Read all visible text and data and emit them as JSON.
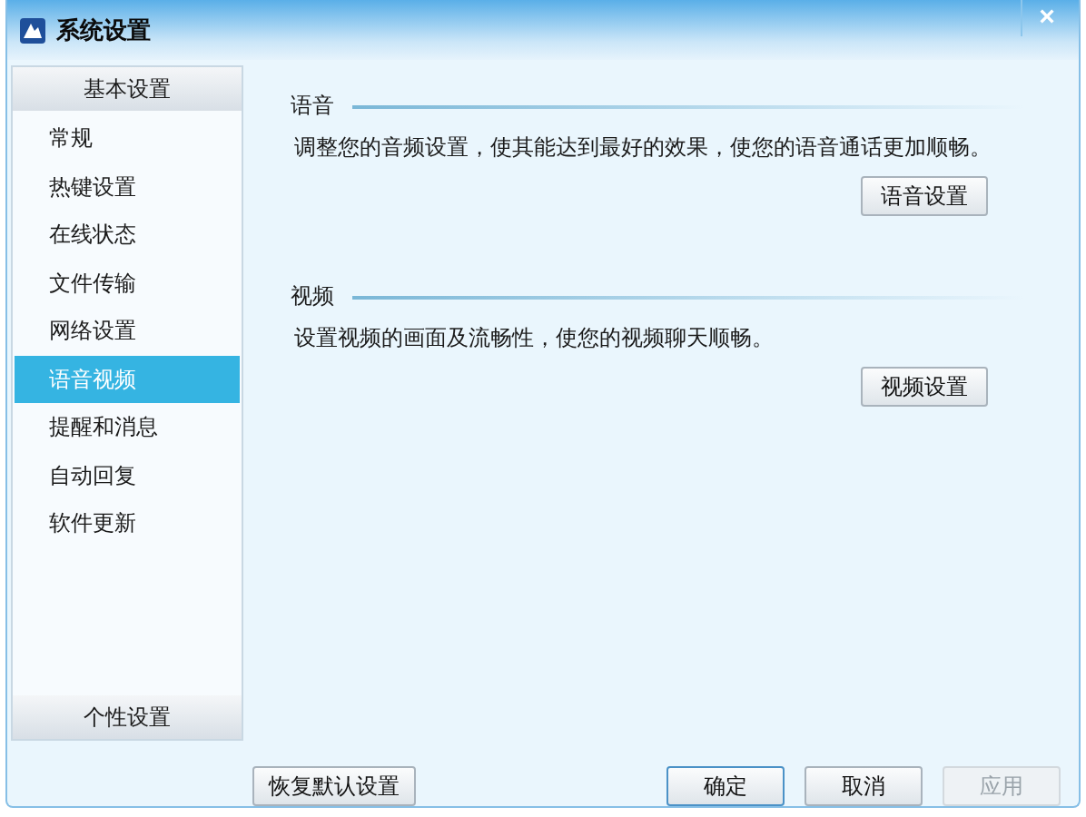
{
  "window": {
    "title": "系统设置",
    "close": "×"
  },
  "sidebar": {
    "header": "基本设置",
    "items": [
      {
        "label": "常规",
        "selected": false
      },
      {
        "label": "热键设置",
        "selected": false
      },
      {
        "label": "在线状态",
        "selected": false
      },
      {
        "label": "文件传输",
        "selected": false
      },
      {
        "label": "网络设置",
        "selected": false
      },
      {
        "label": "语音视频",
        "selected": true
      },
      {
        "label": "提醒和消息",
        "selected": false
      },
      {
        "label": "自动回复",
        "selected": false
      },
      {
        "label": "软件更新",
        "selected": false
      }
    ],
    "footer_group": "个性设置"
  },
  "sections": [
    {
      "title": "语音",
      "description": "调整您的音频设置，使其能达到最好的效果，使您的语音通话更加顺畅。",
      "button": "语音设置"
    },
    {
      "title": "视频",
      "description": "设置视频的画面及流畅性，使您的视频聊天顺畅。",
      "button": "视频设置"
    }
  ],
  "footer": {
    "reset_button": "恢复默认设置",
    "buttons": [
      {
        "label": "确定",
        "kind": "default",
        "disabled": false
      },
      {
        "label": "取消",
        "kind": "normal",
        "disabled": false
      },
      {
        "label": "应用",
        "kind": "normal",
        "disabled": true
      }
    ]
  }
}
